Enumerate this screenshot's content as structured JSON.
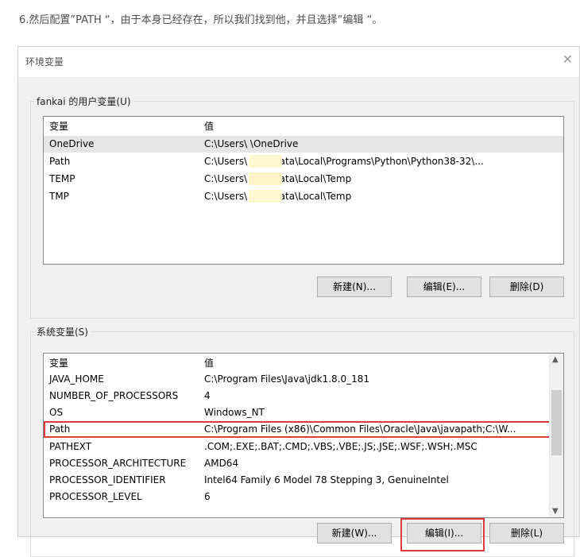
{
  "caption": "6.然后配置”PATH “，由于本身已经存在，所以我们找到他，并且选择”编辑 “。",
  "dialog": {
    "title": "环境变量",
    "close_icon": "close-icon",
    "user_group": {
      "legend": "fankai 的用户变量(U)",
      "columns": [
        "变量",
        "值"
      ],
      "rows": [
        {
          "name": "OneDrive",
          "value": "C:\\Users\\        \\OneDrive"
        },
        {
          "name": "Path",
          "value": "C:\\Users\\        \\AppData\\Local\\Programs\\Python\\Python38-32\\..."
        },
        {
          "name": "TEMP",
          "value": "C:\\Users\\        \\AppData\\Local\\Temp"
        },
        {
          "name": "TMP",
          "value": "C:\\Users\\        \\AppData\\Local\\Temp"
        }
      ],
      "buttons": {
        "new": "新建(N)...",
        "edit": "编辑(E)...",
        "delete": "删除(D)"
      }
    },
    "system_group": {
      "legend": "系统变量(S)",
      "columns": [
        "变量",
        "值"
      ],
      "rows": [
        {
          "name": "JAVA_HOME",
          "value": "C:\\Program Files\\Java\\jdk1.8.0_181"
        },
        {
          "name": "NUMBER_OF_PROCESSORS",
          "value": "4"
        },
        {
          "name": "OS",
          "value": "Windows_NT"
        },
        {
          "name": "Path",
          "value": "C:\\Program Files (x86)\\Common Files\\Oracle\\Java\\javapath;C:\\W..."
        },
        {
          "name": "PATHEXT",
          "value": ".COM;.EXE;.BAT;.CMD;.VBS;.VBE;.JS;.JSE;.WSF;.WSH;.MSC"
        },
        {
          "name": "PROCESSOR_ARCHITECTURE",
          "value": "AMD64"
        },
        {
          "name": "PROCESSOR_IDENTIFIER",
          "value": "Intel64 Family 6 Model 78 Stepping 3, GenuineIntel"
        },
        {
          "name": "PROCESSOR_LEVEL",
          "value": "6"
        }
      ],
      "highlighted_row": "Path",
      "buttons": {
        "new": "新建(W)...",
        "edit": "编辑(I)...",
        "delete": "删除(L)"
      }
    },
    "colors": {
      "highlight": "#e23a3a",
      "selected_row": "#e5e5e5"
    }
  }
}
